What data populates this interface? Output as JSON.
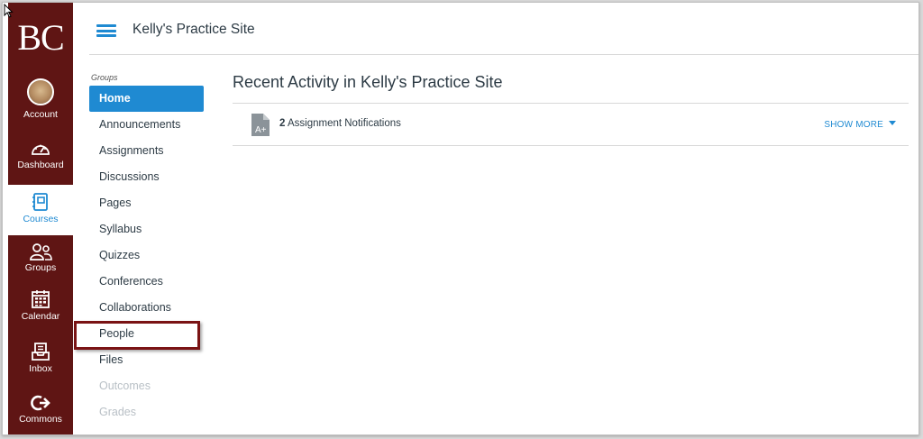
{
  "global_nav": {
    "logo": "BC",
    "items": [
      {
        "label": "Account"
      },
      {
        "label": "Dashboard"
      },
      {
        "label": "Courses"
      },
      {
        "label": "Groups"
      },
      {
        "label": "Calendar"
      },
      {
        "label": "Inbox"
      },
      {
        "label": "Commons"
      }
    ],
    "active": "Courses",
    "bg_color": "#5f1514",
    "accent_color": "#1f8ad2"
  },
  "header": {
    "site_title": "Kelly's Practice Site"
  },
  "course_nav": {
    "section_label": "Groups",
    "items": [
      {
        "label": "Home",
        "state": "active"
      },
      {
        "label": "Announcements"
      },
      {
        "label": "Assignments"
      },
      {
        "label": "Discussions"
      },
      {
        "label": "Pages"
      },
      {
        "label": "Syllabus"
      },
      {
        "label": "Quizzes"
      },
      {
        "label": "Conferences"
      },
      {
        "label": "Collaborations"
      },
      {
        "label": "People",
        "state": "highlighted"
      },
      {
        "label": "Files"
      },
      {
        "label": "Outcomes",
        "state": "disabled"
      },
      {
        "label": "Grades",
        "state": "disabled"
      }
    ]
  },
  "main": {
    "title": "Recent Activity in Kelly's Practice Site",
    "activity": {
      "count": "2",
      "text": "Assignment Notifications",
      "show_more": "SHOW MORE",
      "icon": "assignment-doc-icon"
    }
  }
}
